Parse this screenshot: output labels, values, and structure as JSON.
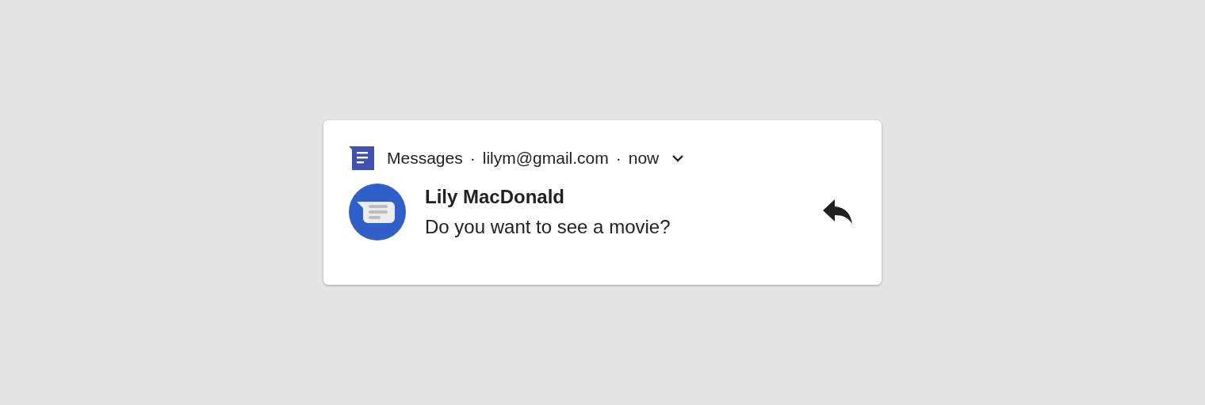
{
  "notification": {
    "header": {
      "app": "Messages",
      "separator_1": "·",
      "account": "lilym@gmail.com",
      "separator_2": "·",
      "time": "now",
      "expanded": false
    },
    "sender": "Lily MacDonald",
    "message": "Do you want to see a movie?"
  }
}
